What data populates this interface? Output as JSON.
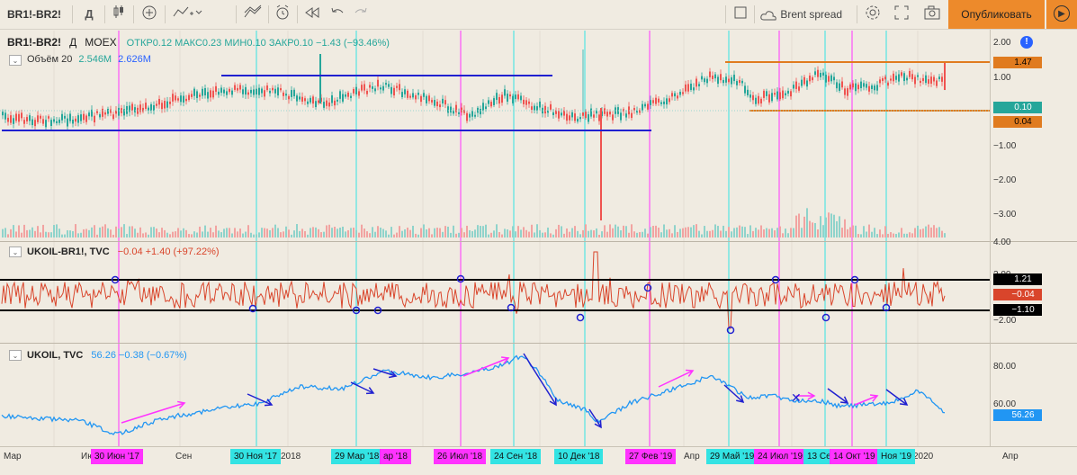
{
  "toolbar": {
    "symbol": "BR1!-BR2!",
    "interval": "Д",
    "brent_layout": "Brent spread",
    "publish": "Опубликовать"
  },
  "icons": [
    "compare-plus-icon",
    "indicators-icon",
    "templates-icon",
    "alert-icon",
    "replay-icon",
    "undo-icon",
    "redo-icon",
    "layout-square-icon",
    "cloud-icon",
    "gear-icon",
    "fullscreen-icon",
    "camera-icon",
    "play-icon",
    "chart-type-icon"
  ],
  "pane1": {
    "title": "BR1!-BR2!",
    "interval": "Д",
    "exchange": "MOEX",
    "ohlc": "ОТКР0.12  МАКС0.23  МИН0.10  ЗАКР0.10  −1.43 (−93.46%)",
    "volume_label": "Объём 20",
    "volume_v1": "2.546M",
    "volume_v2": "2.626M",
    "y_ticks": [
      "2.00",
      "1.00",
      "−1.00",
      "−2.00",
      "−3.00"
    ],
    "tags": [
      {
        "text": "1.47",
        "bg": "#e07b1f",
        "fg": "#000"
      },
      {
        "text": "0.10",
        "bg": "#26a69a",
        "fg": "#fff"
      },
      {
        "text": "0.04",
        "bg": "#e07b1f",
        "fg": "#000"
      }
    ]
  },
  "pane2": {
    "title": "UKOIL-BR1!, TVC",
    "value": "−0.04  +1.40 (+97.22%)",
    "y_ticks": [
      "4.00",
      "2.00",
      "−2.00"
    ],
    "tags": [
      {
        "text": "1.21",
        "bg": "#000000",
        "fg": "#fff"
      },
      {
        "text": "−0.04",
        "bg": "#d9452b",
        "fg": "#fff"
      },
      {
        "text": "−1.10",
        "bg": "#000000",
        "fg": "#fff"
      }
    ]
  },
  "pane3": {
    "title": "UKOIL, TVC",
    "value": "56.26  −0.38 (−0.67%)",
    "y_ticks": [
      "80.00",
      "60.00"
    ],
    "tags": [
      {
        "text": "56.26",
        "bg": "#2196f3",
        "fg": "#fff"
      }
    ]
  },
  "x_labels": [
    "Мар",
    "Ию",
    "Сен",
    "2018",
    "Апр",
    "2020",
    "Апр"
  ],
  "x_badges": [
    {
      "text": "30 Июн '17",
      "bg": "#ff33ff"
    },
    {
      "text": "30 Ноя '17",
      "bg": "#33e3e3"
    },
    {
      "text": "29 Мар '18",
      "bg": "#33e3e3"
    },
    {
      "text": "ар '18",
      "bg": "#ff33ff"
    },
    {
      "text": "26 Июл '18",
      "bg": "#ff33ff"
    },
    {
      "text": "24 Сен '18",
      "bg": "#33e3e3"
    },
    {
      "text": "10 Дек '18",
      "bg": "#33e3e3"
    },
    {
      "text": "27 Фев '19",
      "bg": "#ff33ff"
    },
    {
      "text": "29 Май '19",
      "bg": "#33e3e3"
    },
    {
      "text": "24 Июл '19",
      "bg": "#ff33ff"
    },
    {
      "text": "13 Се",
      "bg": "#33e3e3"
    },
    {
      "text": "14 Окт '19",
      "bg": "#ff33ff"
    },
    {
      "text": "Ноя '19",
      "bg": "#33e3e3"
    }
  ],
  "colors": {
    "bg": "#f0ebe1",
    "up": "#26a69a",
    "down": "#ef5350",
    "spread": "#d9452b",
    "ukoil": "#2196f3",
    "hline": "#2020d0",
    "orange": "#e07b1f",
    "magenta": "#ff33ff",
    "cyan": "#33e3e3"
  }
}
